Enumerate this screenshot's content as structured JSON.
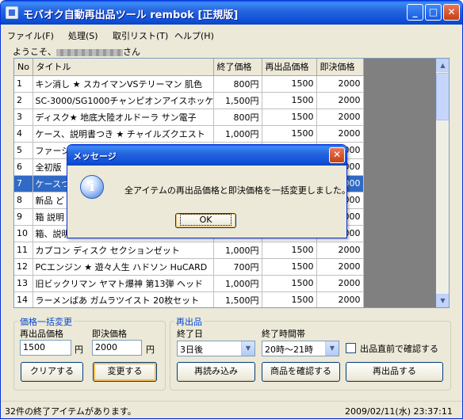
{
  "window": {
    "title": "モバオク自動再出品ツール rembok [正規版]"
  },
  "menu": [
    "ファイル(F)",
    "処理(S)",
    "取引リスト(T)",
    "ヘルプ(H)"
  ],
  "greeting": {
    "prefix": "ようこそ、",
    "suffix": "さん"
  },
  "table": {
    "columns": [
      "No",
      "タイトル",
      "終了価格",
      "再出品価格",
      "即決価格"
    ],
    "rows": [
      {
        "no": "1",
        "title": "キン消し ★ スカイマンVSテリーマン 肌色",
        "end": "800円",
        "relist": "1500",
        "buyout": "2000"
      },
      {
        "no": "2",
        "title": "SC-3000/SG1000チャンピオンアイスホッケー",
        "end": "1,500円",
        "relist": "1500",
        "buyout": "2000"
      },
      {
        "no": "3",
        "title": "ディスク★ 地底大陸オルドーラ サン電子",
        "end": "800円",
        "relist": "1500",
        "buyout": "2000"
      },
      {
        "no": "4",
        "title": "ケース、説明書つき ★ チャイルズクエスト",
        "end": "1,000円",
        "relist": "1500",
        "buyout": "2000"
      },
      {
        "no": "5",
        "title": "ファージア",
        "end": "",
        "relist": "",
        "buyout": "2000"
      },
      {
        "no": "6",
        "title": "全初版",
        "end": "",
        "relist": "",
        "buyout": "2000"
      },
      {
        "no": "7",
        "title": "ケースつき",
        "end": "",
        "relist": "",
        "buyout": "2000"
      },
      {
        "no": "8",
        "title": "新品 ど",
        "end": "",
        "relist": "",
        "buyout": "2000"
      },
      {
        "no": "9",
        "title": "箱 説明",
        "end": "",
        "relist": "",
        "buyout": "2000"
      },
      {
        "no": "10",
        "title": "箱、説明",
        "end": "",
        "relist": "",
        "buyout": "2000"
      },
      {
        "no": "11",
        "title": "カプコン ディスク セクションゼット",
        "end": "1,000円",
        "relist": "1500",
        "buyout": "2000"
      },
      {
        "no": "12",
        "title": "PCエンジン ★ 遊々人生 ハドソン HuCARD",
        "end": "700円",
        "relist": "1500",
        "buyout": "2000"
      },
      {
        "no": "13",
        "title": "旧ビックリマン ヤマト爆神 第13弾 ヘッド",
        "end": "1,000円",
        "relist": "1500",
        "buyout": "2000"
      },
      {
        "no": "14",
        "title": "ラーメンばあ ガムラツイスト 20枚セット",
        "end": "1,500円",
        "relist": "1500",
        "buyout": "2000"
      }
    ],
    "selected_row": "7"
  },
  "bulk_price": {
    "legend": "価格一括変更",
    "relist_label": "再出品価格",
    "relist_value": "1500",
    "buyout_label": "即決価格",
    "buyout_value": "2000",
    "unit": "円",
    "clear_button": "クリアする",
    "change_button": "変更する"
  },
  "relist": {
    "legend": "再出品",
    "end_day_label": "終了日",
    "end_day_value": "3日後",
    "end_time_label": "終了時間帯",
    "end_time_value": "20時～21時",
    "confirm_checkbox": "出品直前で確認する",
    "reload_button": "再読み込み",
    "check_button": "商品を確認する",
    "relist_button": "再出品する"
  },
  "status": {
    "left": "32件の終了アイテムがあります。",
    "right": "2009/02/11(水) 23:37:11"
  },
  "dialog": {
    "title": "メッセージ",
    "message": "全アイテムの再出品価格と即決価格を一括変更しました。",
    "ok": "OK"
  }
}
